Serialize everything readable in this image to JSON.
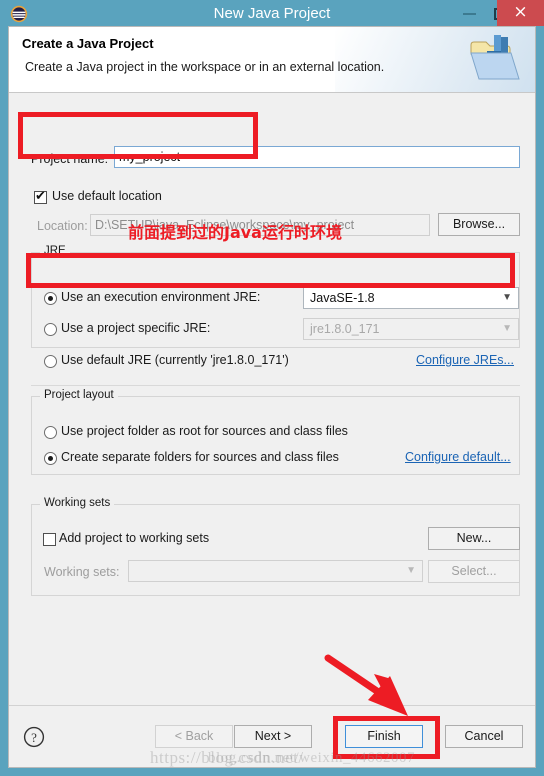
{
  "window": {
    "title": "New Java Project",
    "app_icon": "eclipse-icon",
    "minimize_label": "Minimize",
    "maximize_label": "Maximize",
    "close_label": "×",
    "titlebar_color": "#5AA3BE",
    "close_button_color": "#CC4B4F"
  },
  "header": {
    "title": "Create a Java Project",
    "description": "Create a Java project in the workspace or in an external location.",
    "icon": "java-project-folder-icon"
  },
  "project_name": {
    "label": "Project name:",
    "value": "my_project",
    "placeholder": ""
  },
  "location": {
    "use_default_label": "Use default location",
    "use_default_checked": true,
    "label": "Location:",
    "value": "D:\\SETUP\\java_Eclipse\\workspace\\my_project",
    "browse_label": "Browse..."
  },
  "jre": {
    "group_title": "JRE",
    "options": [
      {
        "label": "Use an execution environment JRE:",
        "selected": true
      },
      {
        "label": "Use a project specific JRE:",
        "selected": false
      },
      {
        "label": "Use default JRE (currently 'jre1.8.0_171')",
        "selected": false
      }
    ],
    "execution_env_value": "JavaSE-1.8",
    "project_specific_value": "jre1.8.0_171",
    "configure_link": "Configure JREs..."
  },
  "project_layout": {
    "group_title": "Project layout",
    "options": [
      {
        "label": "Use project folder as root for sources and class files",
        "selected": false
      },
      {
        "label": "Create separate folders for sources and class files",
        "selected": true
      }
    ],
    "configure_link": "Configure default..."
  },
  "working_sets": {
    "group_title": "Working sets",
    "add_label": "Add project to working sets",
    "add_checked": false,
    "label": "Working sets:",
    "value": "",
    "new_label": "New...",
    "select_label": "Select..."
  },
  "footer": {
    "help_icon": "help-question-icon",
    "back_label": "< Back",
    "back_enabled": false,
    "next_label": "Next >",
    "finish_label": "Finish",
    "cancel_label": "Cancel"
  },
  "annotations": {
    "jre_note": "前面提到过的Java运行时环境",
    "highlight_color": "#ED1C24",
    "arrow": "red-arrow-pointing-to-finish"
  },
  "watermark": {
    "text": "https://blog.csdn.net/",
    "overlay": "blog.csdn.net/weixin_44662007"
  }
}
